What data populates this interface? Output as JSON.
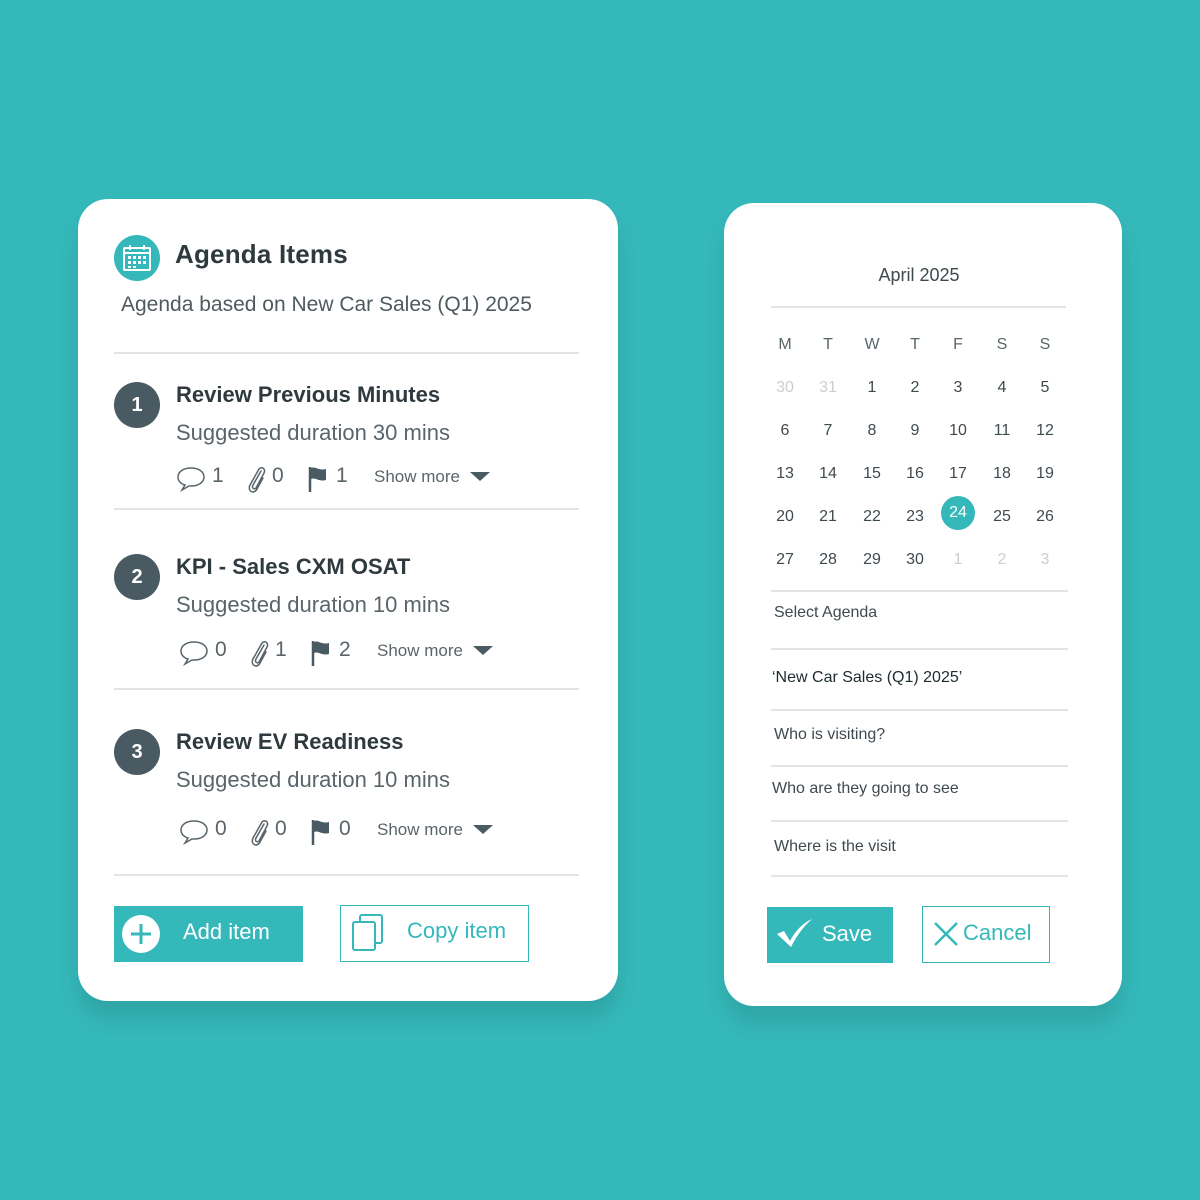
{
  "agenda": {
    "title": "Agenda Items",
    "subtitle": "Agenda based on New Car Sales (Q1) 2025",
    "items": [
      {
        "number": "1",
        "title": "Review Previous Minutes",
        "duration": "Suggested duration 30 mins",
        "comments": "1",
        "attachments": "0",
        "flags": "1",
        "show_more": "Show more"
      },
      {
        "number": "2",
        "title": "KPI - Sales CXM OSAT",
        "duration": "Suggested duration 10 mins",
        "comments": "0",
        "attachments": "1",
        "flags": "2",
        "show_more": "Show more"
      },
      {
        "number": "3",
        "title": "Review EV Readiness",
        "duration": "Suggested duration 10 mins",
        "comments": "0",
        "attachments": "0",
        "flags": "0",
        "show_more": "Show more"
      }
    ],
    "add_label": "Add item",
    "copy_label": "Copy item"
  },
  "calendar": {
    "month_label": "April 2025",
    "weekdays": [
      "M",
      "T",
      "W",
      "T",
      "F",
      "S",
      "S"
    ],
    "weeks": [
      [
        "30",
        "31",
        "1",
        "2",
        "3",
        "4",
        "5"
      ],
      [
        "6",
        "7",
        "8",
        "9",
        "10",
        "11",
        "12"
      ],
      [
        "13",
        "14",
        "15",
        "16",
        "17",
        "18",
        "19"
      ],
      [
        "20",
        "21",
        "22",
        "23",
        "24",
        "25",
        "26"
      ],
      [
        "27",
        "28",
        "29",
        "30",
        "1",
        "2",
        "3"
      ]
    ],
    "selected_day": "24"
  },
  "form": {
    "select_agenda_label": "Select Agenda",
    "selected_agenda": "‘New Car Sales (Q1) 2025’",
    "visitor_placeholder": "Who is visiting?",
    "seeing_placeholder": "Who are they going to see",
    "location_placeholder": "Where is the visit",
    "save_label": "Save",
    "cancel_label": "Cancel"
  },
  "colors": {
    "accent": "#35b8ba",
    "badge": "#4a5a62",
    "background": "#35b8ba"
  }
}
